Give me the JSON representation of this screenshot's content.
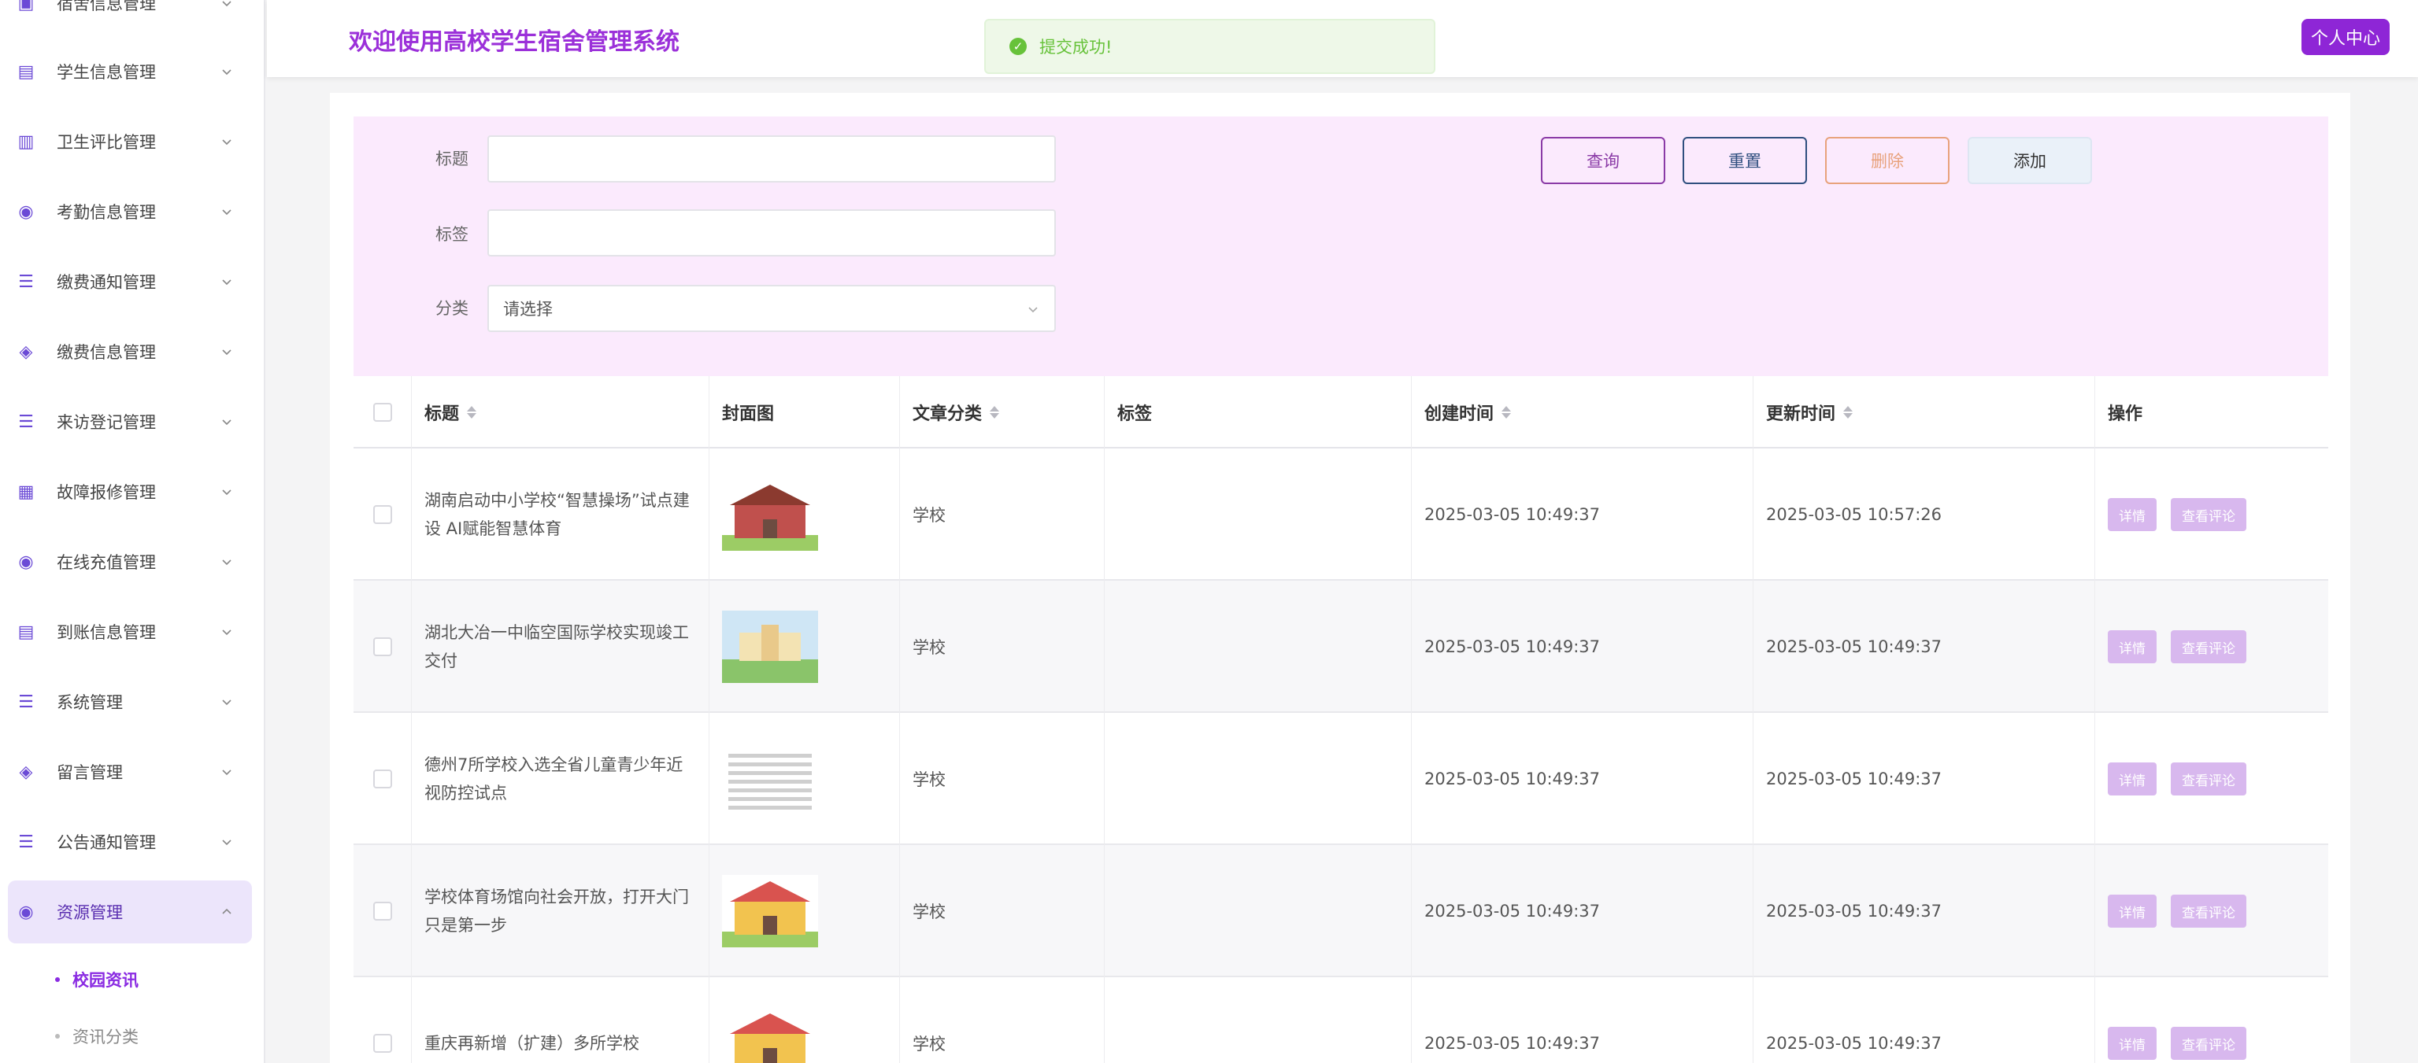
{
  "header": {
    "title": "欢迎使用高校学生宿舍管理系统",
    "user_center": "个人中心"
  },
  "toast": {
    "message": "提交成功!"
  },
  "sidebar": {
    "items": [
      {
        "label": "宿舍信息管理",
        "icon": "dorm-icon"
      },
      {
        "label": "学生信息管理",
        "icon": "student-icon"
      },
      {
        "label": "卫生评比管理",
        "icon": "hygiene-icon"
      },
      {
        "label": "考勤信息管理",
        "icon": "attendance-icon"
      },
      {
        "label": "缴费通知管理",
        "icon": "list-icon"
      },
      {
        "label": "缴费信息管理",
        "icon": "payment-icon"
      },
      {
        "label": "来访登记管理",
        "icon": "list-icon"
      },
      {
        "label": "故障报修管理",
        "icon": "repair-icon"
      },
      {
        "label": "在线充值管理",
        "icon": "recharge-icon"
      },
      {
        "label": "到账信息管理",
        "icon": "account-icon"
      },
      {
        "label": "系统管理",
        "icon": "list-icon"
      },
      {
        "label": "留言管理",
        "icon": "message-icon"
      },
      {
        "label": "公告通知管理",
        "icon": "list-icon"
      },
      {
        "label": "资源管理",
        "icon": "resource-icon"
      }
    ],
    "sub_items": [
      {
        "label": "校园资讯"
      },
      {
        "label": "资讯分类"
      }
    ]
  },
  "filter": {
    "title_label": "标题",
    "tag_label": "标签",
    "category_label": "分类",
    "category_placeholder": "请选择",
    "buttons": {
      "query": "查询",
      "reset": "重置",
      "delete": "删除",
      "add": "添加"
    }
  },
  "table": {
    "headers": {
      "title": "标题",
      "cover": "封面图",
      "category": "文章分类",
      "tag": "标签",
      "created": "创建时间",
      "updated": "更新时间",
      "actions": "操作"
    },
    "action_labels": {
      "detail": "详情",
      "comments": "查看评论"
    },
    "rows": [
      {
        "title": "湖南启动中小学校“智慧操场”试点建设 AI赋能智慧体育",
        "category": "学校",
        "tag": "",
        "created": "2025-03-05 10:49:37",
        "updated": "2025-03-05 10:57:26"
      },
      {
        "title": "湖北大冶一中临空国际学校实现竣工交付",
        "category": "学校",
        "tag": "",
        "created": "2025-03-05 10:49:37",
        "updated": "2025-03-05 10:49:37"
      },
      {
        "title": "德州7所学校入选全省儿童青少年近视防控试点",
        "category": "学校",
        "tag": "",
        "created": "2025-03-05 10:49:37",
        "updated": "2025-03-05 10:49:37"
      },
      {
        "title": "学校体育场馆向社会开放，打开大门只是第一步",
        "category": "学校",
        "tag": "",
        "created": "2025-03-05 10:49:37",
        "updated": "2025-03-05 10:49:37"
      },
      {
        "title": "重庆再新增（扩建）多所学校",
        "category": "学校",
        "tag": "",
        "created": "2025-03-05 10:49:37",
        "updated": "2025-03-05 10:49:37"
      }
    ]
  },
  "colors": {
    "accent": "#9b30d9",
    "filter_bg": "#fbeafd",
    "success": "#67c23a"
  }
}
